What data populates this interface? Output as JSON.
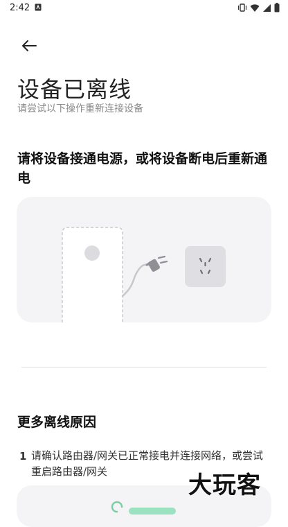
{
  "status_bar": {
    "time": "2:42",
    "icons": [
      "app-notification-icon",
      "vibrate-icon",
      "wifi-icon",
      "signal-icon",
      "battery-icon"
    ]
  },
  "header": {
    "back_icon": "arrow-left-icon"
  },
  "page": {
    "title": "设备已离线",
    "subtitle": "请尝试以下操作重新连接设备"
  },
  "step": {
    "heading": "请将设备接通电源，或将设备断电后重新通电",
    "illustration": [
      "device-body",
      "power-cable",
      "plug-icon",
      "wall-socket-icon"
    ]
  },
  "more": {
    "title": "更多离线原因",
    "reasons": [
      {
        "number": "1",
        "text": "请确认路由器/网关已正常接电并连接网络，或尝试重启路由器/网关"
      }
    ]
  },
  "watermark": "大玩客",
  "colors": {
    "card_bg": "#f4f4f6",
    "device_outline": "#c8c8cc",
    "socket_bg": "#dfdfe3",
    "accent_green": "#9be3c0"
  }
}
